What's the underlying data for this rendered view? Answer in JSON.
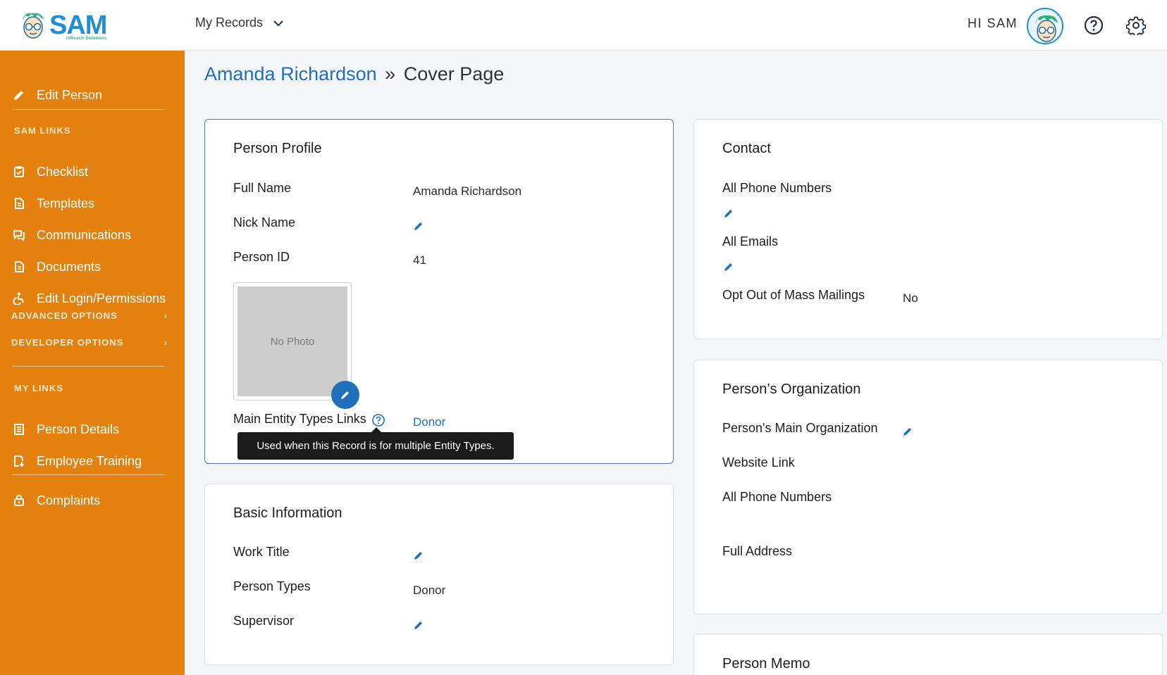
{
  "header": {
    "logo_text": "SAM",
    "logo_subtitle": "InReach Solutions",
    "records_menu": "My Records",
    "greeting": "HI SAM"
  },
  "sidebar": {
    "edit_person": "Edit Person",
    "sam_links_heading": "SAM LINKS",
    "sam_links": [
      {
        "label": "Checklist",
        "icon": "checklist-icon"
      },
      {
        "label": "Templates",
        "icon": "document-icon"
      },
      {
        "label": "Communications",
        "icon": "chat-icon"
      },
      {
        "label": "Documents",
        "icon": "document-icon"
      },
      {
        "label": "Edit Login/Permissions",
        "icon": "accessibility-icon"
      }
    ],
    "advanced_options": "ADVANCED OPTIONS",
    "developer_options": "DEVELOPER OPTIONS",
    "my_links_heading": "MY LINKS",
    "my_links": [
      {
        "label": "Person Details",
        "icon": "list-icon"
      },
      {
        "label": "Employee Training",
        "icon": "download-doc-icon"
      }
    ],
    "complaints": "Complaints",
    "accent_color": "#e4810e"
  },
  "breadcrumb": {
    "person": "Amanda Richardson",
    "separator": "»",
    "page": "Cover Page"
  },
  "person_profile": {
    "title": "Person Profile",
    "full_name_label": "Full Name",
    "full_name_value": "Amanda Richardson",
    "nick_name_label": "Nick Name",
    "person_id_label": "Person ID",
    "person_id_value": "41",
    "photo_placeholder": "No Photo",
    "entity_types_label": "Main Entity Types Links",
    "entity_types_value": "Donor",
    "tooltip": "Used when this Record is for multiple Entity Types."
  },
  "basic_information": {
    "title": "Basic Information",
    "work_title_label": "Work Title",
    "person_types_label": "Person Types",
    "person_types_value": "Donor",
    "supervisor_label": "Supervisor"
  },
  "contact": {
    "title": "Contact",
    "phones_label": "All Phone Numbers",
    "emails_label": "All Emails",
    "opt_out_label": "Opt Out of Mass Mailings",
    "opt_out_value": "No"
  },
  "organization": {
    "title": "Person’s Organization",
    "main_org_label": "Person's Main Organization",
    "website_label": "Website Link",
    "phones_label": "All Phone Numbers",
    "address_label": "Full Address"
  },
  "memo": {
    "title": "Person Memo"
  }
}
